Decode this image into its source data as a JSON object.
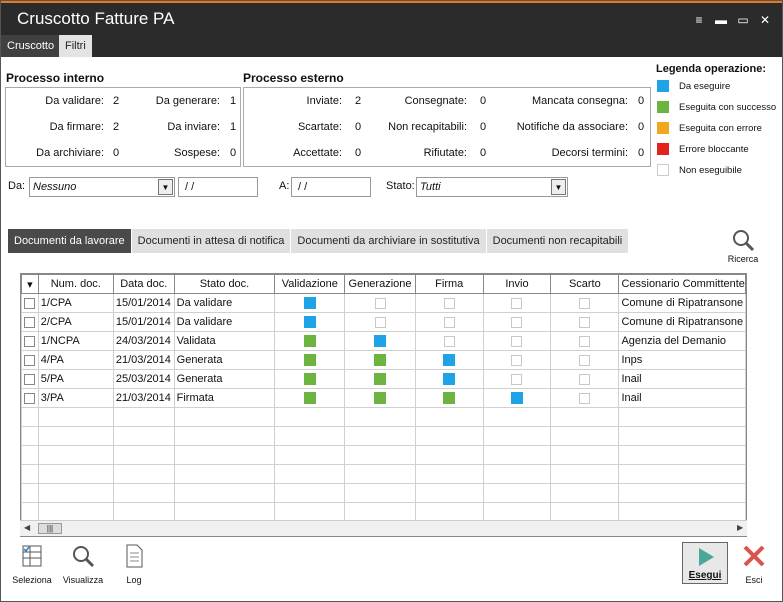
{
  "window": {
    "title": "Cruscotto Fatture PA",
    "controls": [
      "≡",
      "▬",
      "▭",
      "✕"
    ]
  },
  "top_tabs": {
    "cruscotto": "Cruscotto",
    "filtri": "Filtri"
  },
  "interno": {
    "title": "Processo interno",
    "items": [
      {
        "label": "Da validare:",
        "value": "2"
      },
      {
        "label": "Da generare:",
        "value": "1"
      },
      {
        "label": "Da firmare:",
        "value": "2"
      },
      {
        "label": "Da inviare:",
        "value": "1"
      },
      {
        "label": "Da archiviare:",
        "value": "0"
      },
      {
        "label": "Sospese:",
        "value": "0"
      }
    ]
  },
  "esterno": {
    "title": "Processo esterno",
    "items": [
      {
        "label": "Inviate:",
        "value": "2"
      },
      {
        "label": "Consegnate:",
        "value": "0"
      },
      {
        "label": "Mancata consegna:",
        "value": "0"
      },
      {
        "label": "Scartate:",
        "value": "0"
      },
      {
        "label": "Non recapitabili:",
        "value": "0"
      },
      {
        "label": "Notifiche da associare:",
        "value": "0"
      },
      {
        "label": "Accettate:",
        "value": "0"
      },
      {
        "label": "Rifiutate:",
        "value": "0"
      },
      {
        "label": "Decorsi termini:",
        "value": "0"
      }
    ]
  },
  "legenda": {
    "title": "Legenda operazione:",
    "items": [
      {
        "label": "Da eseguire",
        "color": "#1ea3e6"
      },
      {
        "label": "Eseguita con successo",
        "color": "#6cb33f"
      },
      {
        "label": "Eseguita con errore",
        "color": "#f0a81e"
      },
      {
        "label": "Errore bloccante",
        "color": "#e0231b"
      },
      {
        "label": "Non eseguibile",
        "color": "#ffffff"
      }
    ]
  },
  "filters": {
    "da_label": "Da:",
    "da_value": "Nessuno",
    "da_date": "/ /",
    "a_label": "A:",
    "a_date": "/ /",
    "stato_label": "Stato:",
    "stato_value": "Tutti"
  },
  "doc_tabs": [
    "Documenti da lavorare",
    "Documenti in attesa di notifica",
    "Documenti da archiviare in sostitutiva",
    "Documenti non recapitabili"
  ],
  "ricerca": "Ricerca",
  "table": {
    "headers": [
      "Num. doc.",
      "Data doc.",
      "Stato doc.",
      "Validazione",
      "Generazione",
      "Firma",
      "Invio",
      "Scarto",
      "Cessionario Committente"
    ],
    "rows": [
      {
        "num": "1/CPA",
        "data": "15/01/2014",
        "stato": "Da validare",
        "ops": [
          "blue",
          "empty",
          "empty",
          "empty",
          "empty"
        ],
        "cess": "Comune di Ripatransone"
      },
      {
        "num": "2/CPA",
        "data": "15/01/2014",
        "stato": "Da validare",
        "ops": [
          "blue",
          "empty",
          "empty",
          "empty",
          "empty"
        ],
        "cess": "Comune di Ripatransone"
      },
      {
        "num": "1/NCPA",
        "data": "24/03/2014",
        "stato": "Validata",
        "ops": [
          "green",
          "blue",
          "empty",
          "empty",
          "empty"
        ],
        "cess": "Agenzia del Demanio"
      },
      {
        "num": "4/PA",
        "data": "21/03/2014",
        "stato": "Generata",
        "ops": [
          "green",
          "green",
          "blue",
          "empty",
          "empty"
        ],
        "cess": "Inps"
      },
      {
        "num": "5/PA",
        "data": "25/03/2014",
        "stato": "Generata",
        "ops": [
          "green",
          "green",
          "blue",
          "empty",
          "empty"
        ],
        "cess": "Inail"
      },
      {
        "num": "3/PA",
        "data": "21/03/2014",
        "stato": "Firmata",
        "ops": [
          "green",
          "green",
          "green",
          "blue",
          "empty"
        ],
        "cess": "Inail"
      }
    ],
    "colors": {
      "blue": "#1ea3e6",
      "green": "#6cb33f"
    }
  },
  "bottom": {
    "seleziona": "Seleziona",
    "visualizza": "Visualizza",
    "log": "Log",
    "esegui": "Esegui",
    "esci": "Esci"
  }
}
